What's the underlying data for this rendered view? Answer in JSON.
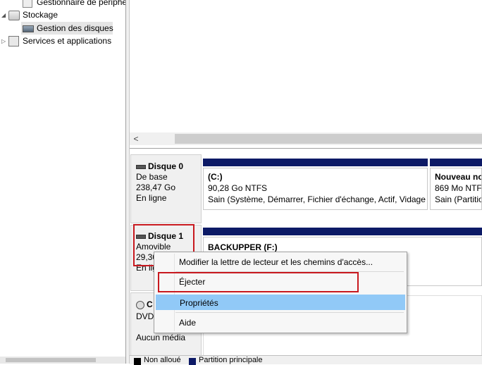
{
  "tree": {
    "items": [
      {
        "label": "Gestionnaire de périphé",
        "icon": "device-manager-icon"
      },
      {
        "label": "Stockage",
        "icon": "storage-icon"
      },
      {
        "label": "Gestion des disques",
        "icon": "disk-management-icon"
      },
      {
        "label": "Services et applications",
        "icon": "services-icon"
      }
    ]
  },
  "scroll": {
    "left_arrow": "<"
  },
  "disks": [
    {
      "name": "Disque 0",
      "type": "De base",
      "size": "238,47 Go",
      "status": "En ligne"
    },
    {
      "name": "Disque 1",
      "type": "Amovible",
      "size": "29,30",
      "status": "En lig"
    },
    {
      "name": "C",
      "type": "DVD",
      "size": "",
      "status": "Aucun média"
    }
  ],
  "partitions": {
    "c": {
      "title": "(C:)",
      "line1": "90,28 Go NTFS",
      "line2": "Sain (Système, Démarrer, Fichier d'échange, Actif, Vidage s"
    },
    "new": {
      "title": "Nouveau no",
      "line1": "869 Mo NTFS",
      "line2": "Sain (Partitio"
    },
    "f": {
      "title": "BACKUPPER  (F:)"
    }
  },
  "context_menu": {
    "items": [
      {
        "label": "Modifier la lettre de lecteur et les chemins d'accès..."
      },
      {
        "label": "Éjecter"
      },
      {
        "label": "Propriétés"
      },
      {
        "label": "Aide"
      }
    ]
  },
  "legend": {
    "unallocated": "Non alloué",
    "primary": "Partition principale",
    "unallocated_color": "#000000",
    "primary_color": "#0d1a66"
  },
  "colors": {
    "highlight": "#91c9f7",
    "annotation_red": "#c8191f",
    "partition_bar": "#0d1a66"
  }
}
